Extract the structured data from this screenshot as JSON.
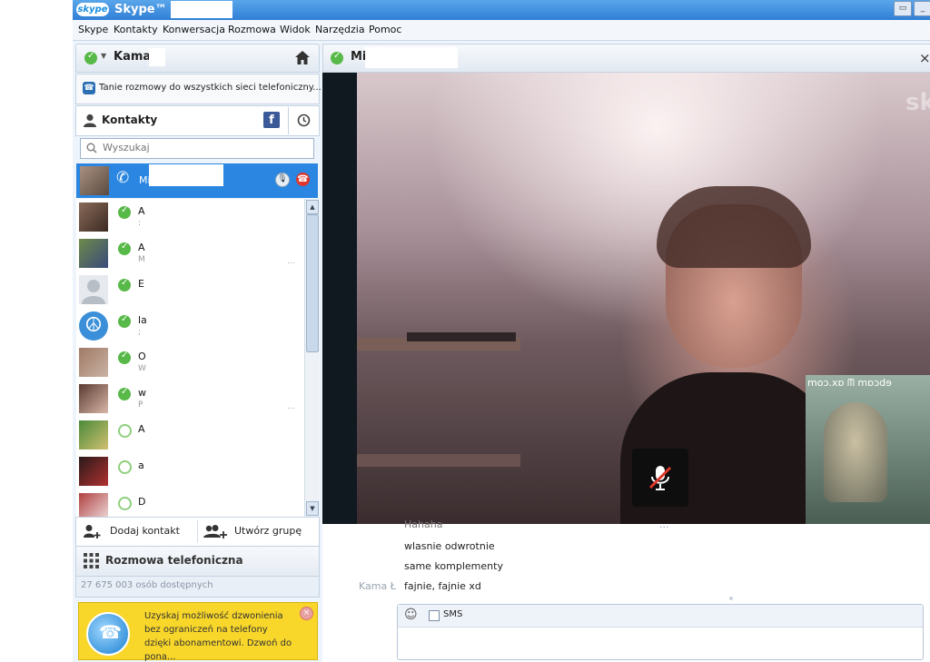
{
  "titlebar": {
    "app_name": "Skype™ -",
    "logo_text": "skype",
    "restore": "▭",
    "minimize": "_"
  },
  "menu": [
    "Skype",
    "Kontakty",
    "Konwersacja",
    "Rozmowa",
    "Widok",
    "Narzędzia",
    "Pomoc"
  ],
  "profile": {
    "name": "Kama",
    "home_icon": "home-icon"
  },
  "promo": {
    "text": "Tanie rozmowy do wszystkich sieci telefoniczny..."
  },
  "contacts": {
    "title": "Kontakty",
    "search_placeholder": "Wyszukaj",
    "selected": {
      "name": "Mi"
    },
    "items": [
      {
        "name": "A",
        "sub": ":",
        "online": true
      },
      {
        "name": "A",
        "sub": "M",
        "online": true,
        "more": "..."
      },
      {
        "name": "E",
        "sub": "",
        "online": true
      },
      {
        "name": "la",
        "sub": ";",
        "online": true
      },
      {
        "name": "O",
        "sub": "W",
        "online": true
      },
      {
        "name": "w",
        "sub": "P",
        "online": true,
        "more": "..."
      },
      {
        "name": "A",
        "sub": "",
        "online": false
      },
      {
        "name": "a",
        "sub": "",
        "online": false
      },
      {
        "name": "D",
        "sub": "",
        "online": false
      }
    ]
  },
  "actions": {
    "add_contact": "Dodaj kontakt",
    "create_group": "Utwórz grupę"
  },
  "phone_call": {
    "label": "Rozmowa telefoniczna"
  },
  "online_count": "27 675 003 osób dostępnych",
  "ad": {
    "text": "Uzyskaj możliwość dzwonienia bez ograniczeń na telefony dzięki abonamentowi. Dzwoń do pona..."
  },
  "conversation": {
    "contact_name": "Mi",
    "close": "×",
    "watermark": "sk",
    "pip_watermark": "moɔ.xɒ ᗰ mɒɔdɘ",
    "messages": [
      {
        "author": "",
        "text": "Hahaha",
        "more": "..."
      },
      {
        "author": "",
        "text": "wlasnie odwrotnie"
      },
      {
        "author": "",
        "text": "same komplementy"
      },
      {
        "author": "Kama Ł",
        "text": "fajnie, fajnie xd"
      }
    ],
    "sms_label": "SMS"
  },
  "colors": {
    "accent": "#2a86e0",
    "online": "#57b947",
    "ad_bg": "#f8d62a"
  }
}
